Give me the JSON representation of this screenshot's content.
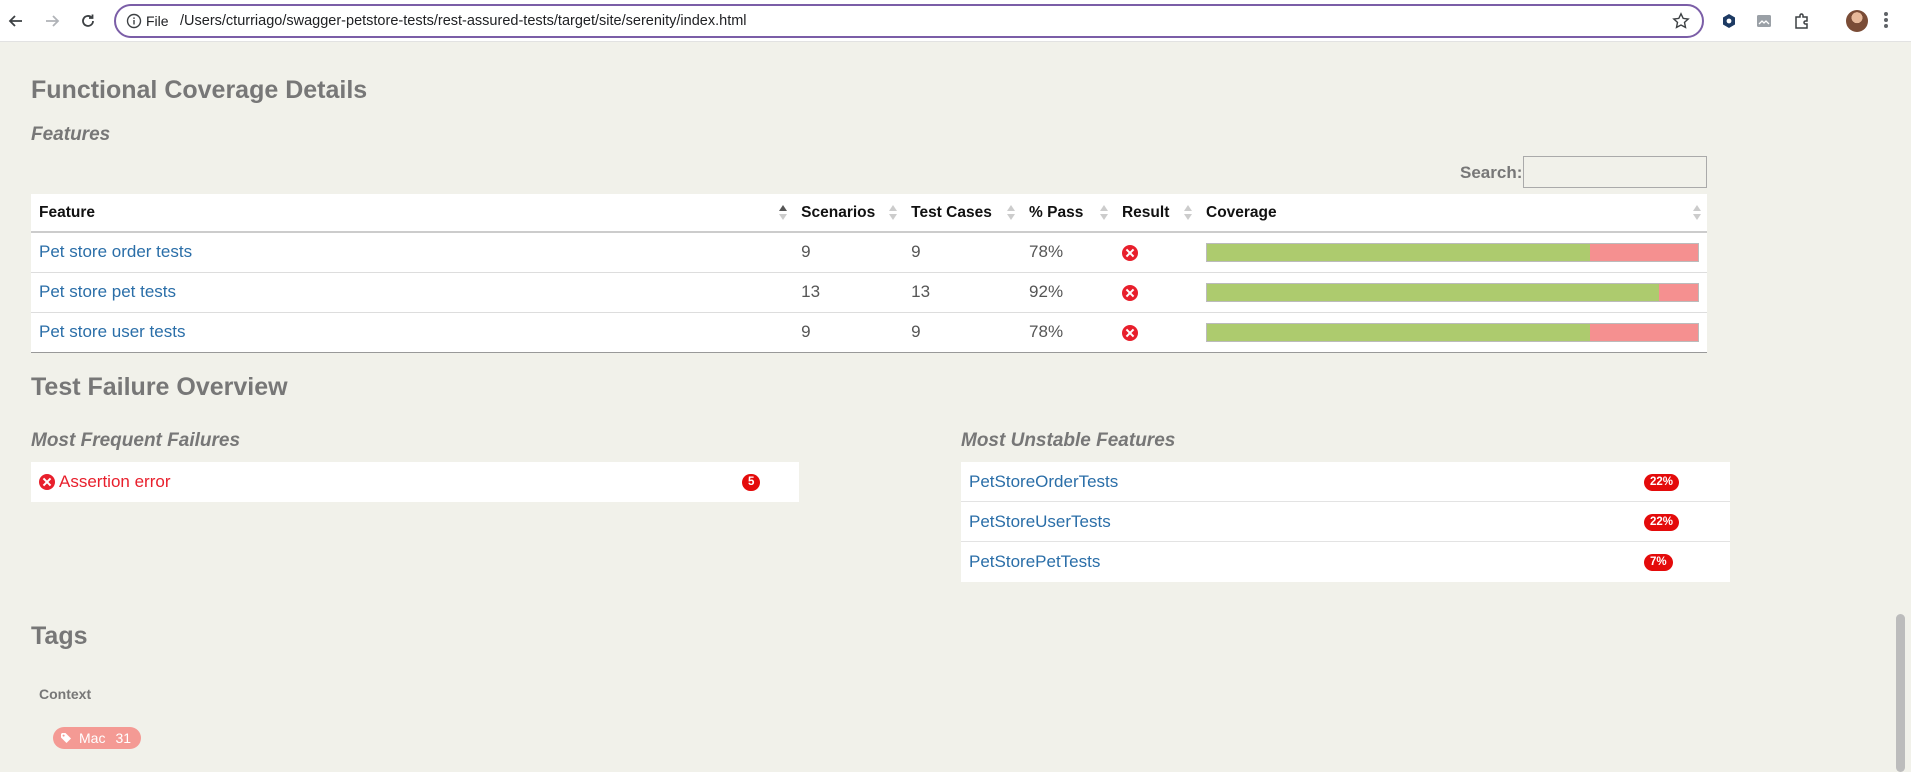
{
  "browser": {
    "file_label": "File",
    "url": "/Users/cturriago/swagger-petstore-tests/rest-assured-tests/target/site/serenity/index.html"
  },
  "coverage": {
    "heading": "Functional Coverage Details",
    "subheading": "Features",
    "search_label": "Search:",
    "search_value": "",
    "columns": [
      "Feature",
      "Scenarios",
      "Test Cases",
      "% Pass",
      "Result",
      "Coverage"
    ],
    "rows": [
      {
        "feature": "Pet store order tests",
        "scenarios": "9",
        "test_cases": "9",
        "pass": "78%",
        "pass_fraction": 0.78,
        "result": "error-icon"
      },
      {
        "feature": "Pet store pet tests",
        "scenarios": "13",
        "test_cases": "13",
        "pass": "92%",
        "pass_fraction": 0.92,
        "result": "error-icon"
      },
      {
        "feature": "Pet store user tests",
        "scenarios": "9",
        "test_cases": "9",
        "pass": "78%",
        "pass_fraction": 0.78,
        "result": "error-icon"
      }
    ],
    "colors": {
      "pass": "#adcb6e",
      "fail": "#f59090"
    }
  },
  "failures": {
    "heading": "Test Failure Overview",
    "frequent_heading": "Most Frequent Failures",
    "frequent": [
      {
        "label": "Assertion error",
        "count": "5"
      }
    ],
    "unstable_heading": "Most Unstable Features",
    "unstable": [
      {
        "label": "PetStoreOrderTests",
        "badge": "22%"
      },
      {
        "label": "PetStoreUserTests",
        "badge": "22%"
      },
      {
        "label": "PetStorePetTests",
        "badge": "7%"
      }
    ]
  },
  "tags": {
    "heading": "Tags",
    "group": "Context",
    "items": [
      {
        "label": "Mac",
        "count": "31"
      }
    ]
  }
}
